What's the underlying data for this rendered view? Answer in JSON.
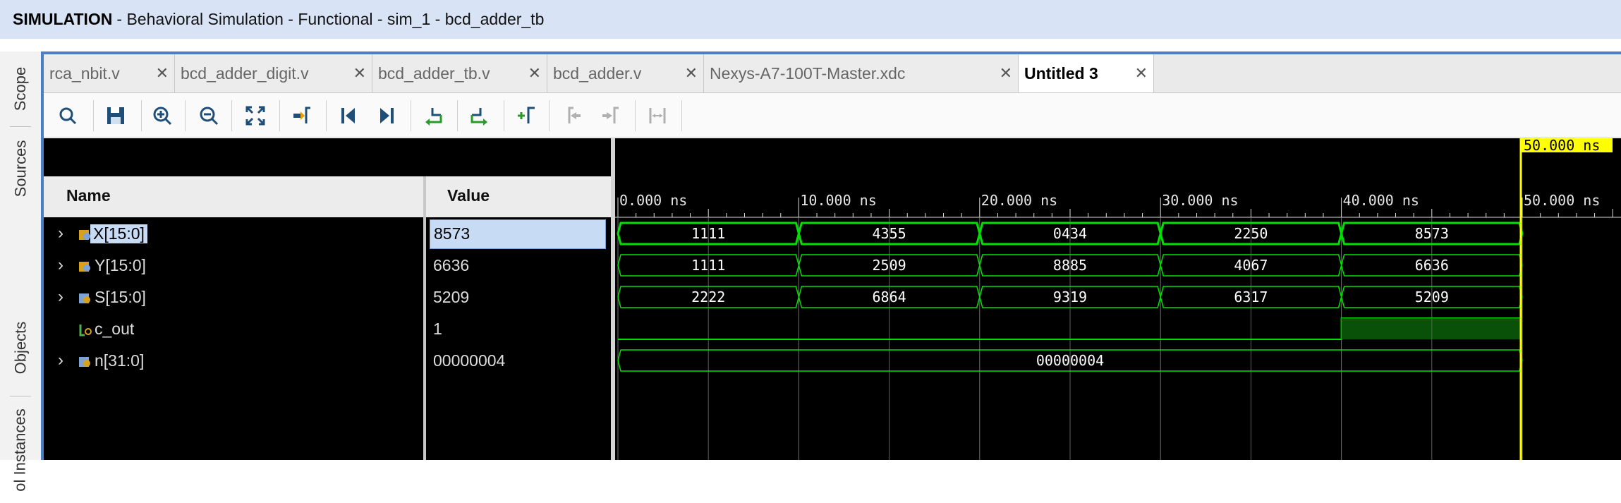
{
  "title": {
    "strong": "SIMULATION",
    "rest": "- Behavioral Simulation - Functional - sim_1 - bcd_adder_tb"
  },
  "side_tabs": [
    "Scope",
    "Sources",
    "Objects",
    "ol Instances"
  ],
  "tabs": [
    {
      "label": "rca_nbit.v"
    },
    {
      "label": "bcd_adder_digit.v"
    },
    {
      "label": "bcd_adder_tb.v"
    },
    {
      "label": "bcd_adder.v"
    },
    {
      "label": "Nexys-A7-100T-Master.xdc"
    },
    {
      "label": "Untitled 3",
      "active": true
    }
  ],
  "toolbar_icons": [
    "search-icon",
    "save-icon",
    "zoom-in-icon",
    "zoom-out-icon",
    "zoom-fit-icon",
    "go-to-cursor-icon",
    "go-to-start-icon",
    "go-to-end-icon",
    "previous-transition-icon",
    "next-transition-icon",
    "add-marker-icon",
    "previous-marker-icon",
    "next-marker-icon",
    "swap-cursors-icon"
  ],
  "columns": {
    "name": "Name",
    "value": "Value"
  },
  "signals": [
    {
      "name": "X[15:0]",
      "value": "8573",
      "expandable": true,
      "segments": [
        "1111",
        "4355",
        "0434",
        "2250",
        "8573"
      ]
    },
    {
      "name": "Y[15:0]",
      "value": "6636",
      "expandable": true,
      "segments": [
        "1111",
        "2509",
        "8885",
        "4067",
        "6636"
      ]
    },
    {
      "name": "S[15:0]",
      "value": "5209",
      "expandable": true,
      "segments": [
        "2222",
        "6864",
        "9319",
        "6317",
        "5209"
      ]
    },
    {
      "name": "c_out",
      "value": "1",
      "expandable": false
    },
    {
      "name": "n[31:0]",
      "value": "00000004",
      "expandable": true,
      "segments": [
        "00000004"
      ]
    }
  ],
  "timeline": {
    "ticks": [
      "0.000 ns",
      "10.000 ns",
      "20.000 ns",
      "30.000 ns",
      "40.000 ns",
      "50.000 ns"
    ],
    "cursor_label": "50.000 ns"
  },
  "colors": {
    "wave": "#00e000",
    "cursor": "#ffff00",
    "selection": "#c7dbf5"
  }
}
